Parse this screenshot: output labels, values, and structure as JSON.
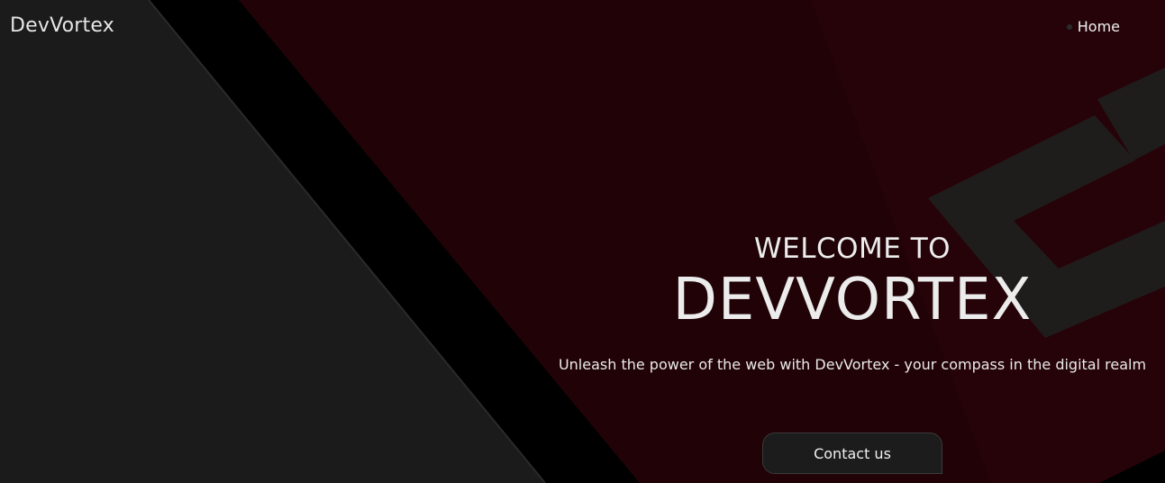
{
  "navbar": {
    "brand": "DevVortex",
    "items": [
      {
        "label": "Home"
      }
    ]
  },
  "hero": {
    "welcome": "WELCOME TO",
    "title": "DEVVORTEX",
    "tagline": "Unleash the power of the web with DevVortex - your compass in the digital realm",
    "cta_label": "Contact us"
  },
  "colors": {
    "background_dark": "#1b1b1b",
    "background_red": "#220307",
    "diagonal_band": "#000000",
    "text": "#ececec",
    "button_bg": "#1c1c1c"
  }
}
